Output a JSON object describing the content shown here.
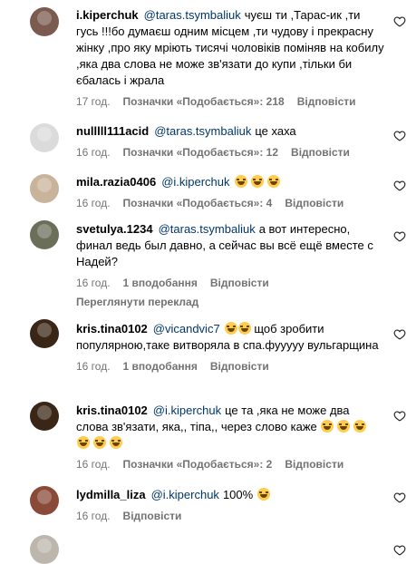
{
  "comments": [
    {
      "username": "i.kiperchuk",
      "mention": "@taras.tsymbaliuk",
      "text": "чуєш ти ,Тарас-ик ,ти гусь !!!бо думаєш одним місцем ,ти чудову і прекрасну жінку ,про яку мріють тисячі чоловіків поміняв на кобилу ,яка два слова не може зв'язати до купи ,тільки би єбалась і жрала",
      "emoji_count": 0,
      "time": "17 год.",
      "likes": "Позначки «Подобається»: 218",
      "reply": "Відповісти",
      "avatar_color": "#7b5a4f"
    },
    {
      "username": "nulllll111acid",
      "mention": "@taras.tsymbaliuk",
      "text": "це хаха",
      "emoji_count": 0,
      "time": "16 год.",
      "likes": "Позначки «Подобається»: 12",
      "reply": "Відповісти",
      "avatar_color": "#dbdbdb"
    },
    {
      "username": "mila.razia0406",
      "mention": "@i.kiperchuk",
      "text": "",
      "emoji_count": 3,
      "time": "16 год.",
      "likes": "Позначки «Подобається»: 4",
      "reply": "Відповісти",
      "avatar_color": "#c9b39a"
    },
    {
      "username": "svetulya.1234",
      "mention": "@taras.tsymbaliuk",
      "text": "а вот интересно, финал ведь был давно, а сейчас вы всё ещё вместе с Надей?",
      "emoji_count": 0,
      "time": "16 год.",
      "likes": "1 вподобання",
      "reply": "Відповісти",
      "translate": "Переглянути переклад",
      "avatar_color": "#6b6f5a"
    },
    {
      "username": "kris.tina0102",
      "mention": "@vicandvic7",
      "text": "щоб зробити популярною,таке витворяла в спа.фууууу вульгарщина",
      "emoji_count": 2,
      "time": "16 год.",
      "likes": "1 вподобання",
      "reply": "Відповісти",
      "avatar_color": "#3a2616"
    },
    {
      "username": "kris.tina0102",
      "mention": "@i.kiperchuk",
      "text": "це та ,яка не може два слова зв'язати, яка,, тіпа,, через слово каже",
      "emoji_count": 6,
      "time": "16 год.",
      "likes": "Позначки «Подобається»: 2",
      "reply": "Відповісти",
      "avatar_color": "#3a2616"
    },
    {
      "username": "lydmilla_liza",
      "mention": "@i.kiperchuk",
      "text": "100%",
      "emoji_count": 1,
      "time": "16 год.",
      "likes": "",
      "reply": "Відповісти",
      "avatar_color": "#8a4a3a"
    },
    {
      "username": "",
      "mention": "",
      "text": "",
      "emoji_count": 0,
      "time": "",
      "likes": "",
      "reply": "",
      "avatar_color": "#bdb6ad"
    }
  ],
  "colors": {
    "mention": "#00376b",
    "meta": "#737373",
    "emoji": "#ffcc4d"
  },
  "icons": {
    "like": "heart-outline-icon"
  }
}
